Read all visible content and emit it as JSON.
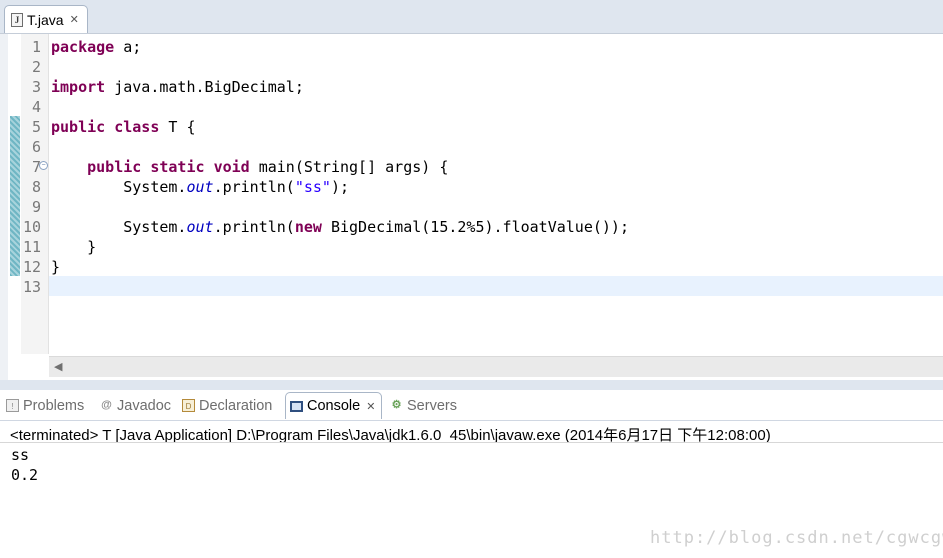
{
  "editor": {
    "tab_label": "T.java",
    "tab_icon": "java-file-icon",
    "tab_icon_glyph": "J",
    "close_glyph": "✕",
    "line_numbers": [
      "1",
      "2",
      "3",
      "4",
      "5",
      "6",
      "7",
      "8",
      "9",
      "10",
      "11",
      "12",
      "13"
    ],
    "fold_glyph": "−",
    "code": [
      [
        {
          "t": "package",
          "c": "kw"
        },
        {
          "t": " a;"
        }
      ],
      [],
      [
        {
          "t": "import",
          "c": "kw"
        },
        {
          "t": " java.math.BigDecimal;"
        }
      ],
      [],
      [
        {
          "t": "public",
          "c": "kw"
        },
        {
          "t": " "
        },
        {
          "t": "class",
          "c": "kw"
        },
        {
          "t": " T {"
        }
      ],
      [],
      [
        {
          "t": "    "
        },
        {
          "t": "public",
          "c": "kw"
        },
        {
          "t": " "
        },
        {
          "t": "static",
          "c": "kw"
        },
        {
          "t": " "
        },
        {
          "t": "void",
          "c": "kw"
        },
        {
          "t": " main(String[] args) {"
        }
      ],
      [
        {
          "t": "        System."
        },
        {
          "t": "out",
          "c": "fld"
        },
        {
          "t": ".println("
        },
        {
          "t": "\"ss\"",
          "c": "str"
        },
        {
          "t": ");"
        }
      ],
      [],
      [
        {
          "t": "        System."
        },
        {
          "t": "out",
          "c": "fld"
        },
        {
          "t": ".println("
        },
        {
          "t": "new",
          "c": "kw"
        },
        {
          "t": " BigDecimal(15.2%5).floatValue());"
        }
      ],
      [
        {
          "t": "    }"
        }
      ],
      [
        {
          "t": "}"
        }
      ],
      []
    ],
    "scroll_left_glyph": "◀"
  },
  "views": {
    "tabs": [
      {
        "label": "Problems",
        "icon": "problems-icon",
        "glyph": "!",
        "active": false
      },
      {
        "label": "Javadoc",
        "icon": "javadoc-icon",
        "glyph": "@",
        "active": false
      },
      {
        "label": "Declaration",
        "icon": "declaration-icon",
        "glyph": "D",
        "active": false
      },
      {
        "label": "Console",
        "icon": "console-icon",
        "glyph": "",
        "active": true
      },
      {
        "label": "Servers",
        "icon": "servers-icon",
        "glyph": "⚙",
        "active": false
      }
    ],
    "close_glyph": "✕"
  },
  "console": {
    "status": "<terminated> T [Java Application] D:\\Program Files\\Java\\jdk1.6.0_45\\bin\\javaw.exe (2014年6月17日 下午12:08:00)",
    "output": [
      "ss",
      "0.2"
    ]
  },
  "watermark": "http://blog.csdn.net/cgwcgw_",
  "colors": {
    "keyword": "#7f0055",
    "string": "#2a00ff",
    "static_field": "#0000c0",
    "current_line": "#e8f2fe",
    "tab_bar": "#dfe6ef"
  }
}
